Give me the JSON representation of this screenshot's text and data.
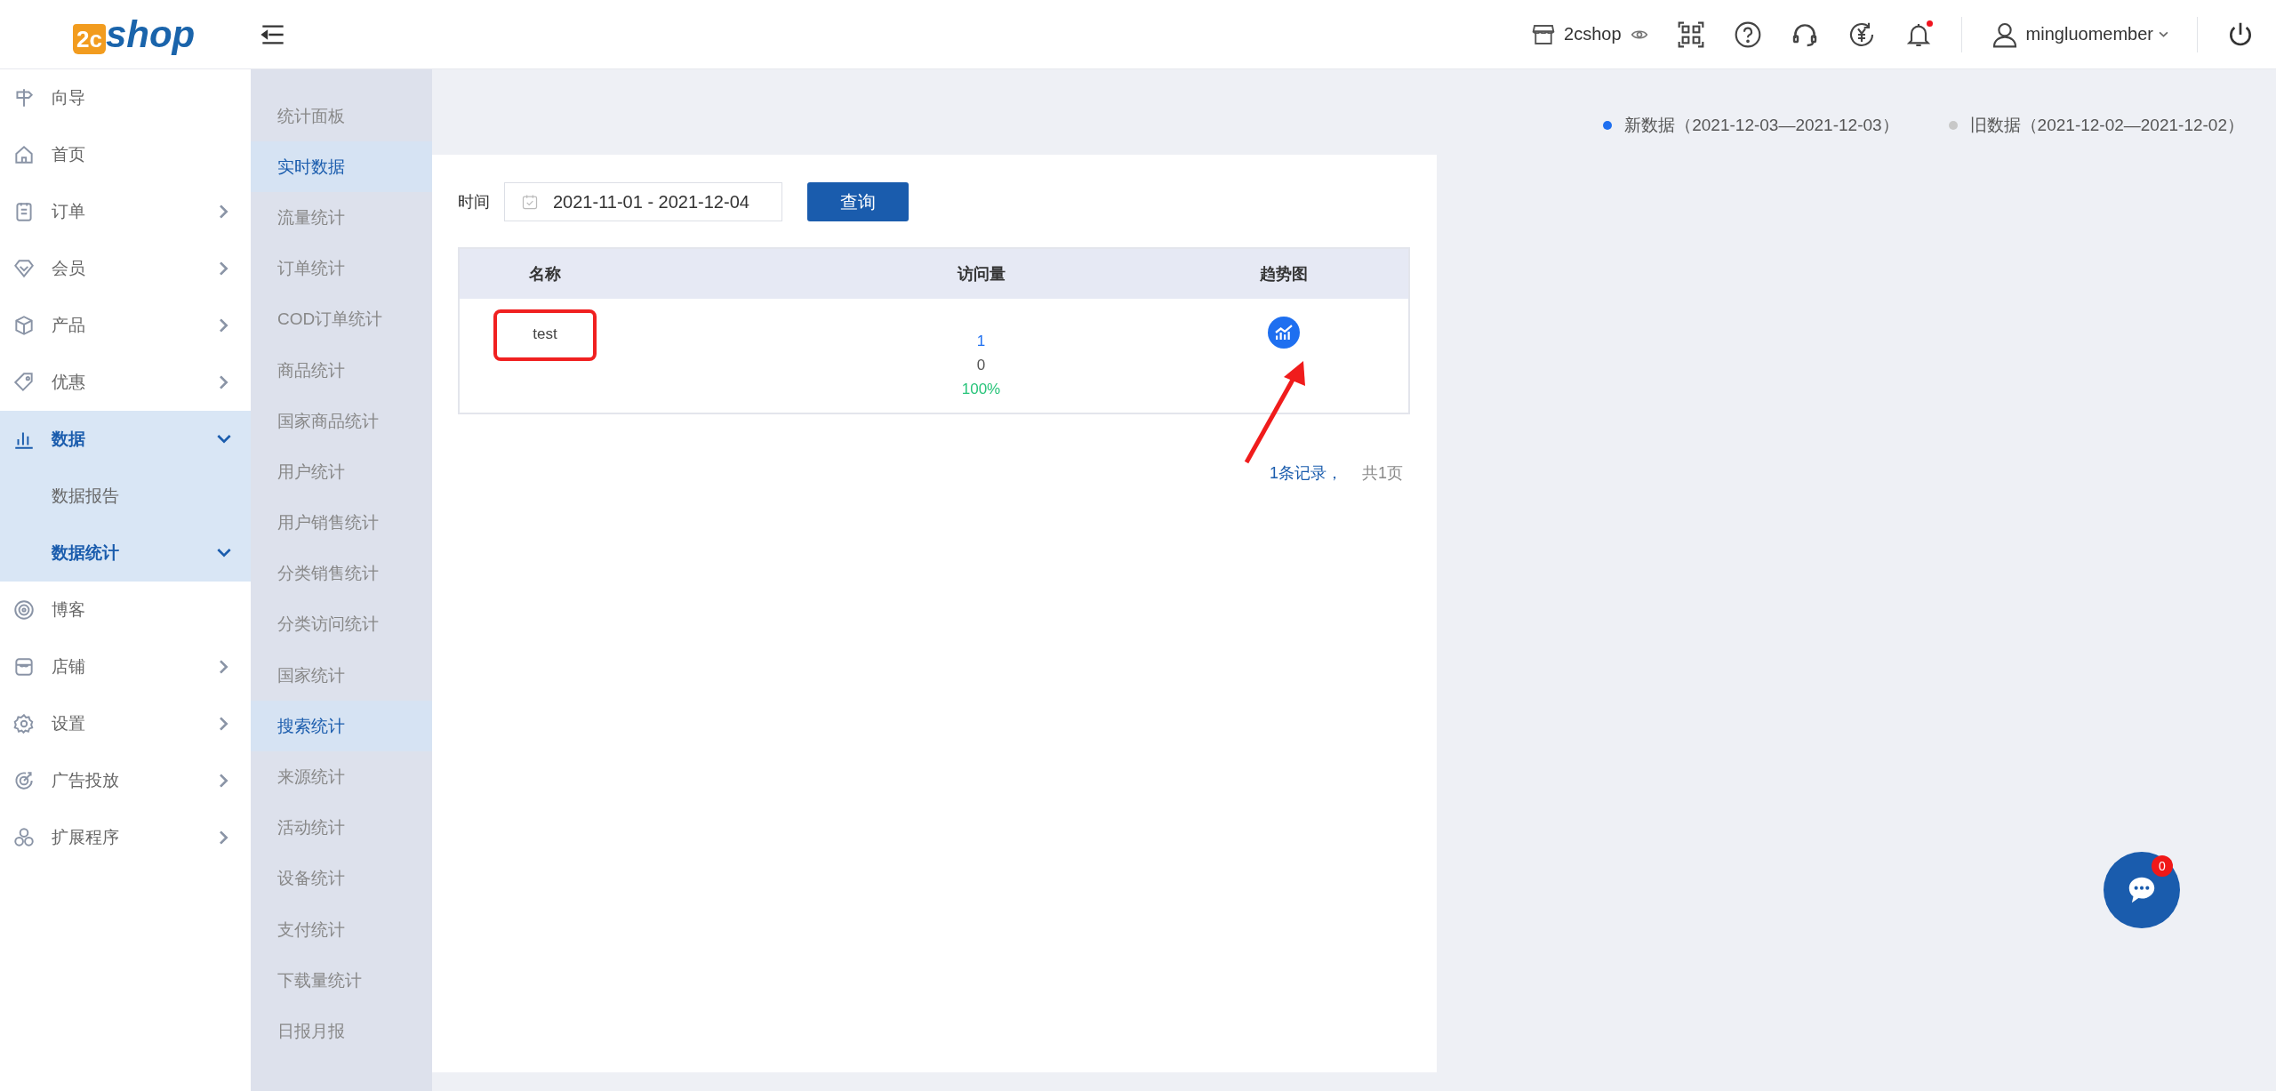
{
  "header": {
    "logo_mark": "2c",
    "logo_text": "shop",
    "store": "2cshop",
    "notifications_unread": true,
    "user": "mingluomember"
  },
  "sidebar": {
    "items": [
      {
        "label": "向导",
        "expandable": false,
        "expanded": false,
        "selected": false
      },
      {
        "label": "首页",
        "expandable": false,
        "expanded": false,
        "selected": false
      },
      {
        "label": "订单",
        "expandable": true,
        "expanded": false,
        "selected": false
      },
      {
        "label": "会员",
        "expandable": true,
        "expanded": false,
        "selected": false
      },
      {
        "label": "产品",
        "expandable": true,
        "expanded": false,
        "selected": false
      },
      {
        "label": "优惠",
        "expandable": true,
        "expanded": false,
        "selected": false
      },
      {
        "label": "数据",
        "expandable": true,
        "expanded": true,
        "selected": true,
        "children": [
          {
            "label": "数据报告",
            "expandable": false,
            "expanded": false,
            "selected": false
          },
          {
            "label": "数据统计",
            "expandable": true,
            "expanded": true,
            "selected": true
          }
        ]
      },
      {
        "label": "博客",
        "expandable": false,
        "expanded": false,
        "selected": false
      },
      {
        "label": "店铺",
        "expandable": true,
        "expanded": false,
        "selected": false
      },
      {
        "label": "设置",
        "expandable": true,
        "expanded": false,
        "selected": false
      },
      {
        "label": "广告投放",
        "expandable": true,
        "expanded": false,
        "selected": false
      },
      {
        "label": "扩展程序",
        "expandable": true,
        "expanded": false,
        "selected": false
      }
    ]
  },
  "subnav": [
    {
      "label": "统计面板",
      "selected": false
    },
    {
      "label": "实时数据",
      "selected": true
    },
    {
      "label": "流量统计",
      "selected": false
    },
    {
      "label": "订单统计",
      "selected": false
    },
    {
      "label": "COD订单统计",
      "selected": false
    },
    {
      "label": "商品统计",
      "selected": false
    },
    {
      "label": "国家商品统计",
      "selected": false
    },
    {
      "label": "用户统计",
      "selected": false
    },
    {
      "label": "用户销售统计",
      "selected": false
    },
    {
      "label": "分类销售统计",
      "selected": false
    },
    {
      "label": "分类访问统计",
      "selected": false
    },
    {
      "label": "国家统计",
      "selected": false
    },
    {
      "label": "搜索统计",
      "selected": true
    },
    {
      "label": "来源统计",
      "selected": false
    },
    {
      "label": "活动统计",
      "selected": false
    },
    {
      "label": "设备统计",
      "selected": false
    },
    {
      "label": "支付统计",
      "selected": false
    },
    {
      "label": "下载量统计",
      "selected": false
    },
    {
      "label": "日报月报",
      "selected": false
    }
  ],
  "legend": [
    {
      "label": "新数据（2021-12-03—2021-12-03）",
      "color": "#1e6ff0"
    },
    {
      "label": "旧数据（2021-12-02—2021-12-02）",
      "color": "#c8c8c8"
    }
  ],
  "filter": {
    "label": "时间",
    "value": "2021-11-01 - 2021-12-04",
    "button": "查询"
  },
  "table": {
    "columns": [
      "名称",
      "访问量",
      "趋势图"
    ],
    "rows": [
      {
        "name": "test",
        "current": "1",
        "previous": "0",
        "change": "100%",
        "annotated": true
      }
    ]
  },
  "pagination": {
    "records": "1条记录，",
    "pages": "共1页"
  },
  "chat": {
    "badge": "0"
  }
}
